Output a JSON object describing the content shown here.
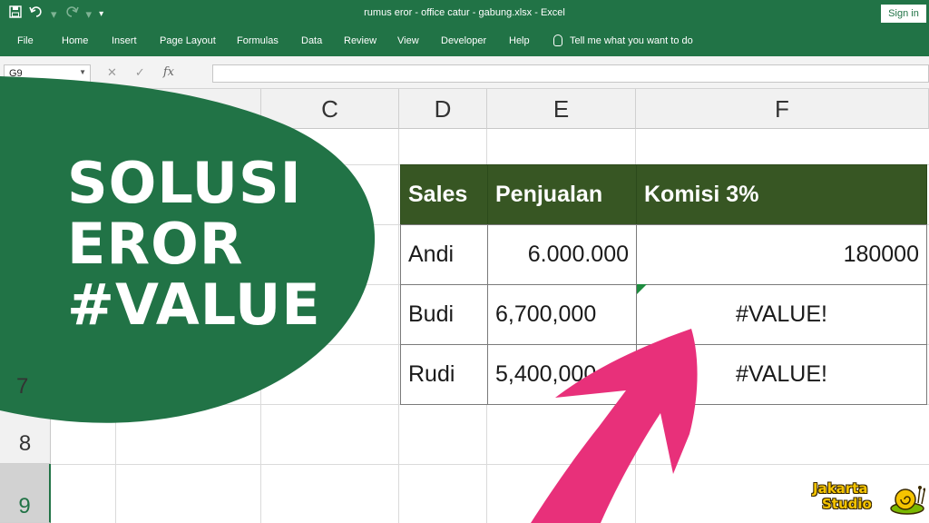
{
  "window": {
    "title": "rumus eror - office catur - gabung.xlsx  -  Excel",
    "sign_in": "Sign in"
  },
  "quick_access": {
    "save_icon": "save-icon",
    "undo_icon": "undo-icon",
    "redo_icon": "redo-icon",
    "customize_icon": "customize-qat-icon"
  },
  "ribbon": {
    "tabs": [
      "File",
      "Home",
      "Insert",
      "Page Layout",
      "Formulas",
      "Data",
      "Review",
      "View",
      "Developer",
      "Help"
    ],
    "tell_me": "Tell me what you want to do"
  },
  "formula_bar": {
    "name_box": "G9",
    "formula": ""
  },
  "sheet": {
    "columns": [
      "C",
      "D",
      "E",
      "F"
    ],
    "rows": [
      "7",
      "8",
      "9"
    ],
    "selected_row": "9"
  },
  "table": {
    "headers": [
      "Sales",
      "Penjualan",
      "Komisi 3%"
    ],
    "rows": [
      [
        "Andi",
        "6.000.000",
        "180000"
      ],
      [
        "Budi",
        "6,700,000",
        "#VALUE!"
      ],
      [
        "Rudi",
        "5,400,000",
        "#VALUE!"
      ]
    ],
    "header_color": "#375623"
  },
  "overlay": {
    "headline": [
      "SOLUSI",
      "EROR",
      "#VALUE"
    ],
    "blob_color": "#217346",
    "arrow_color": "#e8307a"
  },
  "brand": {
    "line1": "Jakarta",
    "line2": "Studio",
    "logo_icon": "snail-logo-icon"
  },
  "colors": {
    "excel_green": "#217346"
  }
}
